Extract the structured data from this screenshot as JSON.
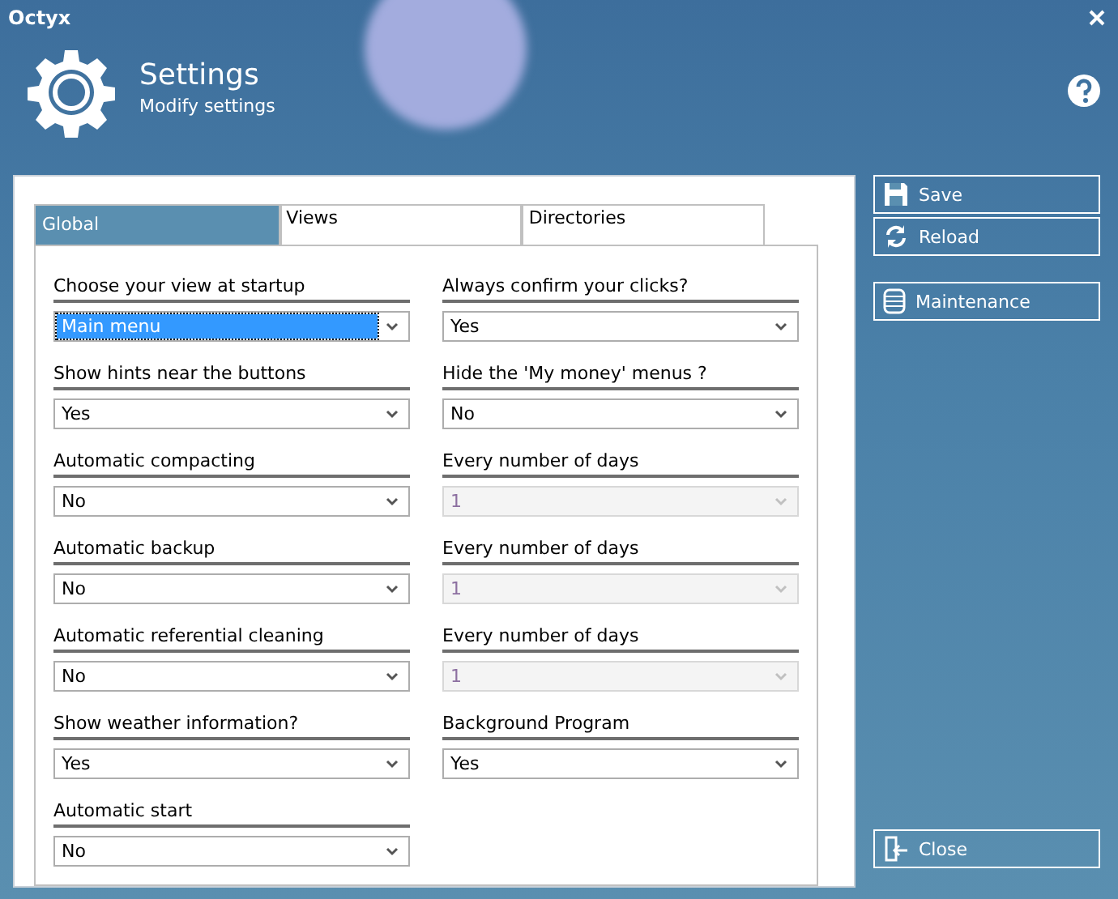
{
  "window": {
    "title": "Octyx"
  },
  "header": {
    "title": "Settings",
    "subtitle": "Modify settings"
  },
  "tabs": [
    {
      "label": "Global",
      "selected": true
    },
    {
      "label": "Views",
      "selected": false
    },
    {
      "label": "Directories",
      "selected": false
    }
  ],
  "left_fields": [
    {
      "label": "Choose your view at startup",
      "value": "Main menu",
      "focused": true,
      "disabled": false
    },
    {
      "label": "Show hints near the buttons",
      "value": "Yes",
      "focused": false,
      "disabled": false
    },
    {
      "label": "Automatic compacting",
      "value": "No",
      "focused": false,
      "disabled": false
    },
    {
      "label": "Automatic backup",
      "value": "No",
      "focused": false,
      "disabled": false
    },
    {
      "label": "Automatic referential cleaning",
      "value": "No",
      "focused": false,
      "disabled": false
    },
    {
      "label": "Show weather information?",
      "value": "Yes",
      "focused": false,
      "disabled": false
    },
    {
      "label": "Automatic start",
      "value": "No",
      "focused": false,
      "disabled": false
    }
  ],
  "right_fields": [
    {
      "label": "Always confirm your clicks?",
      "value": "Yes",
      "focused": false,
      "disabled": false
    },
    {
      "label": "Hide the 'My money' menus ?",
      "value": "No",
      "focused": false,
      "disabled": false
    },
    {
      "label": "Every number of days",
      "value": "1",
      "focused": false,
      "disabled": true
    },
    {
      "label": "Every number of days",
      "value": "1",
      "focused": false,
      "disabled": true
    },
    {
      "label": "Every number of days",
      "value": "1",
      "focused": false,
      "disabled": true
    },
    {
      "label": "Background Program",
      "value": "Yes",
      "focused": false,
      "disabled": false
    }
  ],
  "side_buttons": [
    {
      "label": "Save",
      "kind": "save"
    },
    {
      "label": "Reload",
      "kind": "reload"
    },
    {
      "label": "Maintenance",
      "kind": "maintenance"
    }
  ],
  "close_button": {
    "label": "Close",
    "kind": "close"
  }
}
